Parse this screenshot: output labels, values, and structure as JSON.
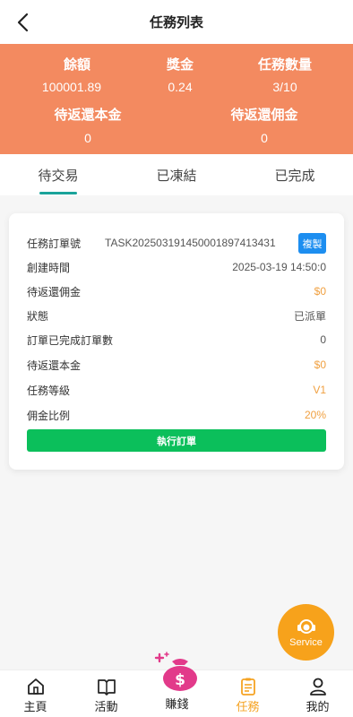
{
  "header": {
    "title": "任務列表"
  },
  "stats": {
    "balance_label": "餘額",
    "balance_value": "100001.89",
    "bonus_label": "獎金",
    "bonus_value": "0.24",
    "task_count_label": "任務數量",
    "task_count_value": "3/10",
    "principal_label": "待返還本金",
    "principal_value": "0",
    "commission_label": "待返還佣金",
    "commission_value": "0"
  },
  "tabs": [
    {
      "label": "待交易",
      "active": true
    },
    {
      "label": "已凍結"
    },
    {
      "label": "已完成"
    }
  ],
  "order": {
    "order_no_label": "任務訂單號",
    "order_no_value": "TASK202503191450001897413431",
    "copy_label": "複製",
    "created_label": "創建時間",
    "created_value": "2025-03-19 14:50:0",
    "pending_commission_label": "待返還佣金",
    "pending_commission_value": "$0",
    "status_label": "狀態",
    "status_value": "已派單",
    "completed_count_label": "訂單已完成訂單數",
    "completed_count_value": "0",
    "pending_principal_label": "待返還本金",
    "pending_principal_value": "$0",
    "level_label": "任務等級",
    "level_value": "V1",
    "commission_rate_label": "佣金比例",
    "commission_rate_value": "20%",
    "execute_label": "執行訂單"
  },
  "service": {
    "label": "Service"
  },
  "nav": [
    {
      "label": "主頁",
      "icon": "home-icon"
    },
    {
      "label": "活動",
      "icon": "book-icon"
    },
    {
      "label": "賺錢",
      "icon": "money-bag-icon"
    },
    {
      "label": "任務",
      "icon": "clipboard-icon",
      "active": true
    },
    {
      "label": "我的",
      "icon": "user-icon"
    }
  ],
  "colors": {
    "stats_bg": "#f38a60",
    "tab_accent": "#1aa39a",
    "copy_button": "#1d8ef0",
    "execute_button": "#0bbf5b",
    "service_button": "#f7a21b",
    "active_nav": "#f5a323",
    "orange_value": "#f0a040"
  }
}
